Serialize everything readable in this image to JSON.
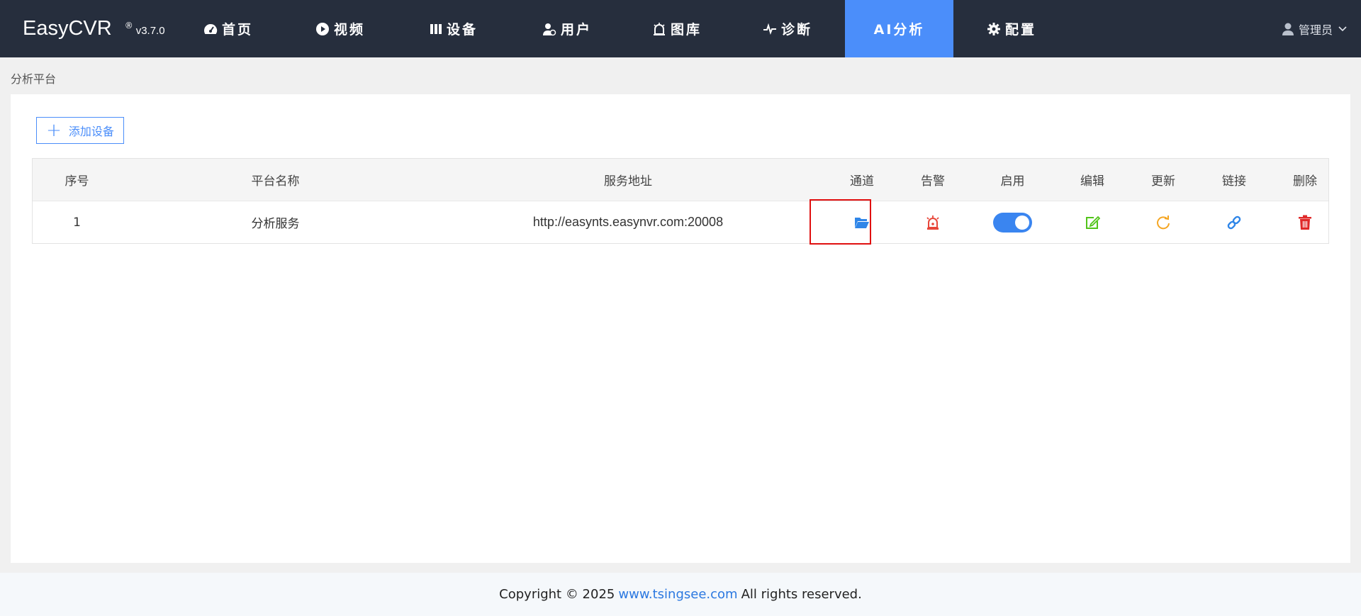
{
  "brand": {
    "name": "EasyCVR",
    "reg": "®",
    "version": "v3.7.0"
  },
  "nav": {
    "home": "首页",
    "video": "视频",
    "device": "设备",
    "user": "用户",
    "gallery": "图库",
    "diagnose": "诊断",
    "ai": "AI分析",
    "config": "配置",
    "active": "AI分析"
  },
  "user_menu": {
    "label": "管理员"
  },
  "breadcrumb": {
    "title": "分析平台"
  },
  "toolbar": {
    "add_label": "添加设备"
  },
  "table": {
    "headers": {
      "index": "序号",
      "name": "平台名称",
      "address": "服务地址",
      "channel": "通道",
      "alarm": "告警",
      "enable": "启用",
      "edit": "编辑",
      "update": "更新",
      "link": "链接",
      "delete": "删除"
    },
    "rows": [
      {
        "index": "1",
        "name": "分析服务",
        "address": "http://easynts.easynvr.com:20008",
        "enabled": true
      }
    ]
  },
  "footer": {
    "prefix": "Copyright © 2025",
    "link": "www.tsingsee.com",
    "suffix": "All rights reserved."
  },
  "colors": {
    "nav_bg": "#262e3d",
    "accent": "#4b8efa",
    "channel_icon": "#2f86e8",
    "alarm_icon": "#e8473a",
    "edit_icon": "#52c41a",
    "update_icon": "#f5a623",
    "link_icon": "#2f86e8",
    "delete_icon": "#e02a2a",
    "highlight": "#e01010"
  },
  "icons": [
    "dashboard-icon",
    "play-icon",
    "device-icon",
    "user-plus-icon",
    "alarm-light-icon",
    "pulse-icon",
    "gear-icon",
    "user-icon",
    "chevron-down-icon",
    "plus-icon",
    "folder-open-icon",
    "alarm-icon",
    "toggle-switch",
    "edit-icon",
    "refresh-icon",
    "link-icon",
    "trash-icon"
  ]
}
